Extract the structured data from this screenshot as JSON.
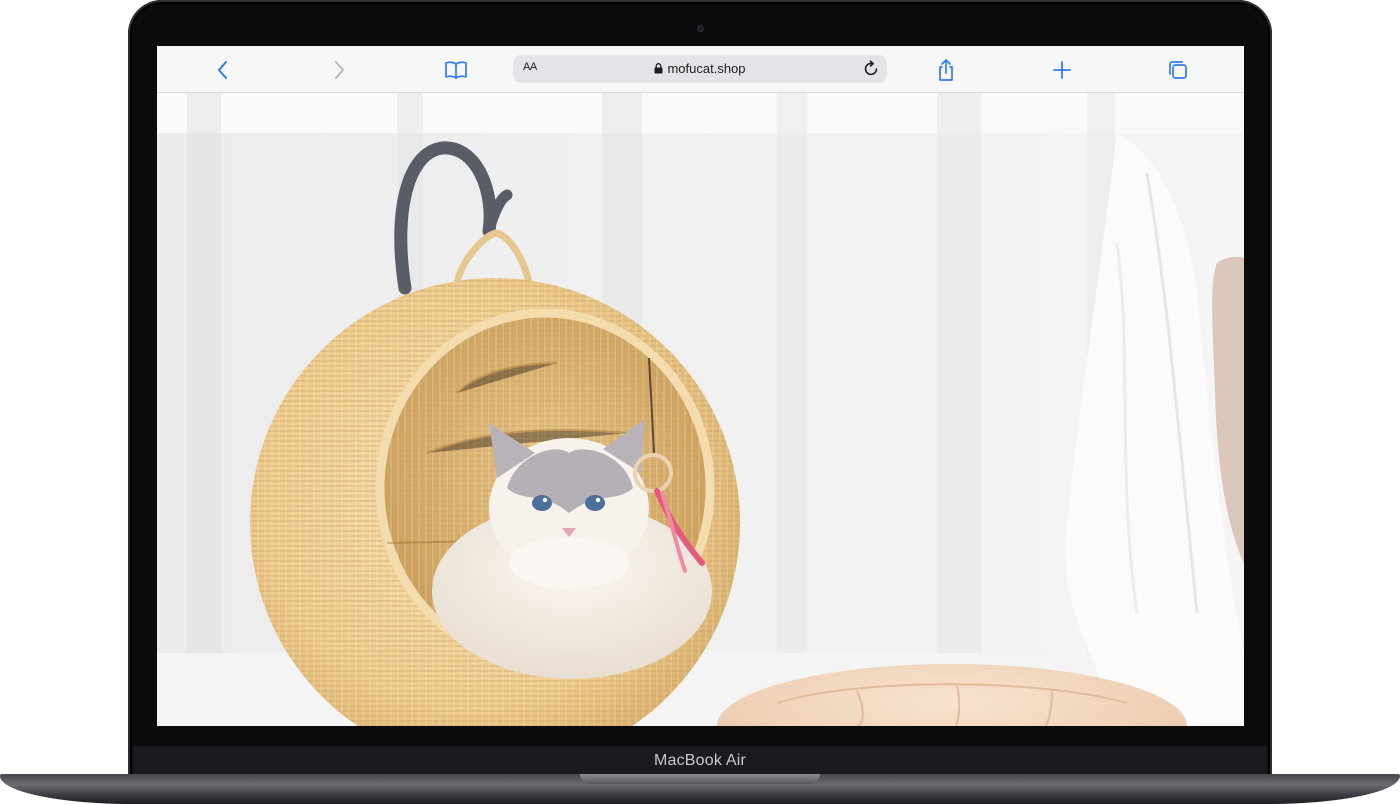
{
  "device": {
    "model_label": "MacBook Air"
  },
  "browser": {
    "address_bar": {
      "text_size_label": "AA",
      "url": "mofucat.shop"
    },
    "icons": [
      "back-icon",
      "forward-icon",
      "bookmarks-icon",
      "lock-icon",
      "reload-icon",
      "share-icon",
      "new-tab-icon",
      "tabs-icon"
    ],
    "accent_color": "#2f7cf6"
  },
  "page": {
    "photo_subject": "ragdoll-cat-in-rattan-hanging-basket-icon"
  }
}
